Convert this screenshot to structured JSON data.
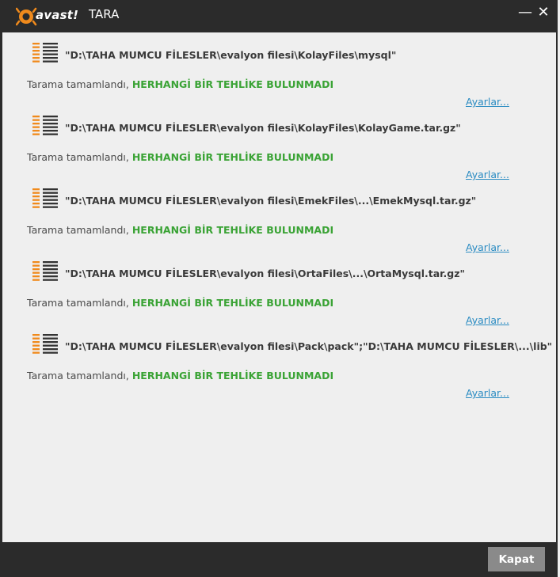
{
  "window": {
    "brand": "avast!",
    "title": "TARA",
    "minimize_glyph": "—",
    "close_glyph": "✕"
  },
  "results": [
    {
      "path": "\"D:\\TAHA MUMCU FİLESLER\\evalyon filesi\\KolayFiles\\mysql\"",
      "status_prefix": "Tarama tamamlandı, ",
      "status_result": "HERHANGİ BİR TEHLİKE BULUNMADI",
      "settings_link": "Ayarlar..."
    },
    {
      "path": "\"D:\\TAHA MUMCU FİLESLER\\evalyon filesi\\KolayFiles\\KolayGame.tar.gz\"",
      "status_prefix": "Tarama tamamlandı, ",
      "status_result": "HERHANGİ BİR TEHLİKE BULUNMADI",
      "settings_link": "Ayarlar..."
    },
    {
      "path": "\"D:\\TAHA MUMCU FİLESLER\\evalyon filesi\\EmekFiles\\...\\EmekMysql.tar.gz\"",
      "status_prefix": "Tarama tamamlandı, ",
      "status_result": "HERHANGİ BİR TEHLİKE BULUNMADI",
      "settings_link": "Ayarlar..."
    },
    {
      "path": "\"D:\\TAHA MUMCU FİLESLER\\evalyon filesi\\OrtaFiles\\...\\OrtaMysql.tar.gz\"",
      "status_prefix": "Tarama tamamlandı, ",
      "status_result": "HERHANGİ BİR TEHLİKE BULUNMADI",
      "settings_link": "Ayarlar..."
    },
    {
      "path": "\"D:\\TAHA MUMCU FİLESLER\\evalyon filesi\\Pack\\pack\";\"D:\\TAHA MUMCU FİLESLER\\...\\lib\"",
      "status_prefix": "Tarama tamamlandı, ",
      "status_result": "HERHANGİ BİR TEHLİKE BULUNMADI",
      "settings_link": "Ayarlar..."
    }
  ],
  "footer": {
    "close_label": "Kapat"
  },
  "colors": {
    "chrome": "#2b2b2b",
    "content_bg": "#efefef",
    "accent_orange": "#f08a1c",
    "ok_green": "#3aa335",
    "link_blue": "#2a8bc2"
  },
  "icons": {
    "brand": "avast-logo",
    "result": "scan-list-icon"
  }
}
